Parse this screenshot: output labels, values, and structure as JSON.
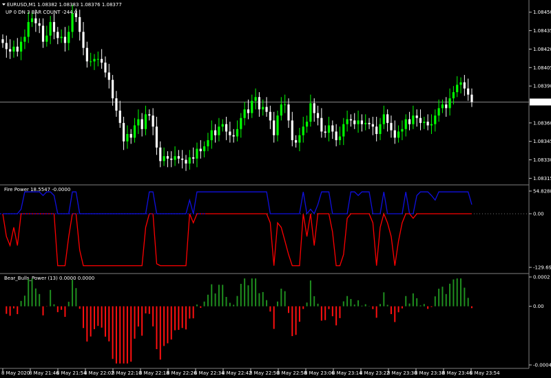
{
  "chart_header": {
    "line1": "EURUSD,M1  1.08382 1.08383 1.08376 1.08377",
    "line2": "UP  0     DN  3  BAR COUNT -244.0"
  },
  "colors": {
    "background": "#000000",
    "bull": "#00ff00",
    "bear": "#ffffff",
    "fire_blue": "#1010e0",
    "fire_red": "#ff0000",
    "bulls_green": "#1f8f1f",
    "bears_red": "#ff1010",
    "axis": "#c0c0c0"
  },
  "price_axis": {
    "ticks": [
      "1.08450",
      "1.08435",
      "1.08420",
      "1.08405",
      "1.08390",
      "1.08360",
      "1.08345",
      "1.08330",
      "1.08315"
    ],
    "current_price": "1.08377"
  },
  "fire_panel": {
    "title": "Fire Power 18.5547 -0.0000",
    "axis_top": "54.8288",
    "axis_zero": "0.00",
    "axis_bottom": "-129.6944"
  },
  "bulls_panel": {
    "title": "Bear_Bulls_Power (13) 0.0000 0.0000",
    "axis_top": "0.0002",
    "axis_zero": "0.00",
    "axis_bottom": "-0.0004"
  },
  "time_axis": {
    "labels": [
      "8 May 2020",
      "8 May 21:46",
      "8 May 21:54",
      "8 May 22:02",
      "8 May 22:10",
      "8 May 22:18",
      "8 May 22:26",
      "8 May 22:34",
      "8 May 22:42",
      "8 May 22:50",
      "8 May 22:58",
      "8 May 23:06",
      "8 May 23:14",
      "8 May 23:22",
      "8 May 23:30",
      "8 May 23:38",
      "8 May 23:46",
      "8 May 23:54"
    ]
  },
  "chart_data": {
    "type": "candlestick",
    "close": [
      1.08425,
      1.0842,
      1.08418,
      1.08422,
      1.08418,
      1.08426,
      1.0843,
      1.08442,
      1.08445,
      1.08441,
      1.08439,
      1.08426,
      1.08431,
      1.08442,
      1.08434,
      1.08429,
      1.0843,
      1.08425,
      1.08434,
      1.08449,
      1.08446,
      1.08434,
      1.08421,
      1.0841,
      1.0841,
      1.08412,
      1.08412,
      1.08409,
      1.08401,
      1.08395,
      1.0838,
      1.0837,
      1.0836,
      1.08345,
      1.08351,
      1.08348,
      1.08358,
      1.08363,
      1.08355,
      1.08367,
      1.08366,
      1.08357,
      1.0834,
      1.08329,
      1.08333,
      1.08331,
      1.0833,
      1.08333,
      1.08331,
      1.0833,
      1.08327,
      1.08332,
      1.08331,
      1.08339,
      1.08337,
      1.08341,
      1.08346,
      1.08354,
      1.0835,
      1.08357,
      1.08359,
      1.08353,
      1.0835,
      1.08349,
      1.08355,
      1.08364,
      1.08371,
      1.08368,
      1.08378,
      1.08381,
      1.08371,
      1.08373,
      1.08369,
      1.08362,
      1.0835,
      1.08366,
      1.08375,
      1.08375,
      1.08362,
      1.08346,
      1.08344,
      1.0835,
      1.08357,
      1.08361,
      1.08376,
      1.08368,
      1.08364,
      1.08353,
      1.08352,
      1.08358,
      1.08353,
      1.08346,
      1.08349,
      1.08359,
      1.08363,
      1.08362,
      1.08359,
      1.08362,
      1.08359,
      1.0836,
      1.08359,
      1.08357,
      1.08351,
      1.08359,
      1.08367,
      1.0836,
      1.08354,
      1.08348,
      1.08353,
      1.08355,
      1.08363,
      1.08359,
      1.08366,
      1.08364,
      1.0836,
      1.08361,
      1.08358,
      1.08359,
      1.08366,
      1.08372,
      1.08375,
      1.08372,
      1.0838,
      1.08385,
      1.08391,
      1.08393,
      1.08388,
      1.08383,
      1.08377
    ],
    "fire_power": {
      "blue_line": "series above zero (max 54.8288)",
      "red_line": "series below zero (min -129.6944)",
      "ylim": [
        -129.6944,
        54.8288
      ]
    },
    "bear_bulls_power": {
      "period": 13,
      "ylim": [
        -0.0004,
        0.0002
      ]
    }
  }
}
